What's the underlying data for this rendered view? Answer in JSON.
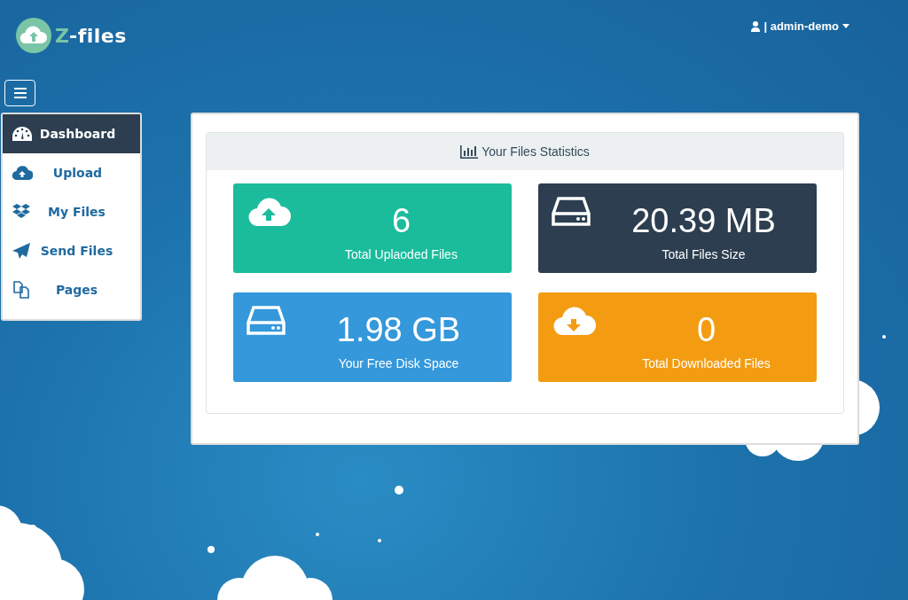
{
  "logo": {
    "accent": "Z",
    "rest": "-files"
  },
  "user_menu": {
    "label": "| admin-demo"
  },
  "sidebar": {
    "items": [
      {
        "label": "Dashboard",
        "kind": "gauge",
        "selected": true
      },
      {
        "label": "Upload",
        "kind": "upload",
        "selected": false
      },
      {
        "label": "My Files",
        "kind": "files",
        "selected": false
      },
      {
        "label": "Send Files",
        "kind": "send",
        "selected": false
      },
      {
        "label": "Pages",
        "kind": "pages",
        "selected": false
      }
    ]
  },
  "statistics": {
    "title": "Your Files Statistics",
    "tiles": [
      {
        "value": "6",
        "label": "Total Uplaoded Files",
        "kind": "upload",
        "color": "#1abc9c"
      },
      {
        "value": "20.39 MB",
        "label": "Total Files Size",
        "kind": "drive",
        "color": "#2c3e50"
      },
      {
        "value": "1.98 GB",
        "label": "Your Free Disk Space",
        "kind": "drive",
        "color": "#3498db"
      },
      {
        "value": "0",
        "label": "Total Downloaded Files",
        "kind": "download",
        "color": "#f39c12"
      }
    ]
  }
}
